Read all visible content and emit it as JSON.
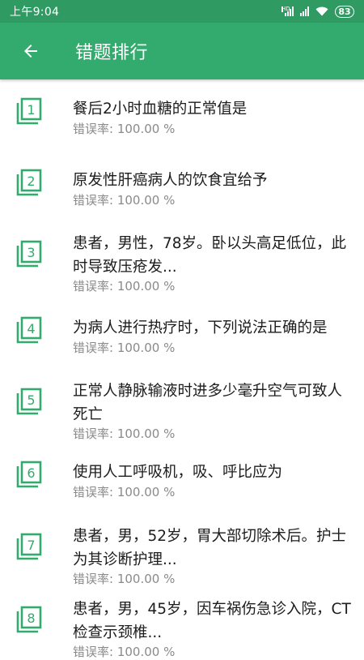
{
  "status_bar": {
    "time": "上午9:04",
    "hd_label": "HD",
    "battery": "83"
  },
  "app_bar": {
    "back_icon": "arrow-left-icon",
    "title": "错题排行"
  },
  "rate_label": "错误率: ",
  "questions": [
    {
      "rank": "1",
      "text": "餐后2小时血糖的正常值是",
      "rate": "100.00 %"
    },
    {
      "rank": "2",
      "text": "原发性肝癌病人的饮食宜给予",
      "rate": "100.00 %"
    },
    {
      "rank": "3",
      "text": "患者，男性，78岁。卧以头高足低位，此时导致压疮发...",
      "rate": "100.00 %"
    },
    {
      "rank": "4",
      "text": "为病人进行热疗时，下列说法正确的是",
      "rate": "100.00 %"
    },
    {
      "rank": "5",
      "text": "正常人静脉输液时进多少毫升空气可致人死亡",
      "rate": "100.00 %"
    },
    {
      "rank": "6",
      "text": "使用人工呼吸机，吸、呼比应为",
      "rate": "100.00 %"
    },
    {
      "rank": "7",
      "text": "患者，男，52岁，胃大部切除术后。护士为其诊断护理...",
      "rate": "100.00 %"
    },
    {
      "rank": "8",
      "text": "患者，男，45岁，因车祸伤急诊入院，CT检查示颈椎...",
      "rate": "100.00 %"
    }
  ],
  "colors": {
    "accent": "#34ab6e",
    "status_bar": "#2f9a62",
    "text": "#1c1c1c",
    "sub_text": "#8a8a8a"
  }
}
